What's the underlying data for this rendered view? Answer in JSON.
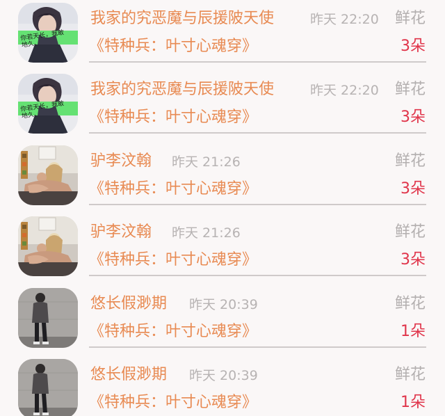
{
  "rows": [
    {
      "avatar": "portrait-calligraphy",
      "user": "我家的究恶魔与辰援陂天使",
      "time": "昨天 22:20",
      "gift": "鲜花",
      "book": "《特种兵：叶寸心魂穿》",
      "count": "3朵"
    },
    {
      "avatar": "portrait-calligraphy",
      "user": "我家的究恶魔与辰援陂天使",
      "time": "昨天 22:20",
      "gift": "鲜花",
      "book": "《特种兵：叶寸心魂穿》",
      "count": "3朵"
    },
    {
      "avatar": "living-room",
      "user": "驴李汶翰",
      "time": "昨天 21:26",
      "gift": "鲜花",
      "book": "《特种兵：叶寸心魂穿》",
      "count": "3朵"
    },
    {
      "avatar": "living-room",
      "user": "驴李汶翰",
      "time": "昨天 21:26",
      "gift": "鲜花",
      "book": "《特种兵：叶寸心魂穿》",
      "count": "3朵"
    },
    {
      "avatar": "street-walker",
      "user": "悠长假渺期",
      "time": "昨天 20:39",
      "gift": "鲜花",
      "book": "《特种兵：叶寸心魂穿》",
      "count": "1朵"
    },
    {
      "avatar": "street-walker",
      "user": "悠长假渺期",
      "time": "昨天 20:39",
      "gift": "鲜花",
      "book": "《特种兵：叶寸心魂穿》",
      "count": "1朵"
    }
  ],
  "avatar_captions": {
    "portrait_calligraphy": "你若天长，我敢地久。"
  },
  "colors": {
    "accent": "#e88a52",
    "count": "#e0344a",
    "muted": "#b7b3b3"
  }
}
